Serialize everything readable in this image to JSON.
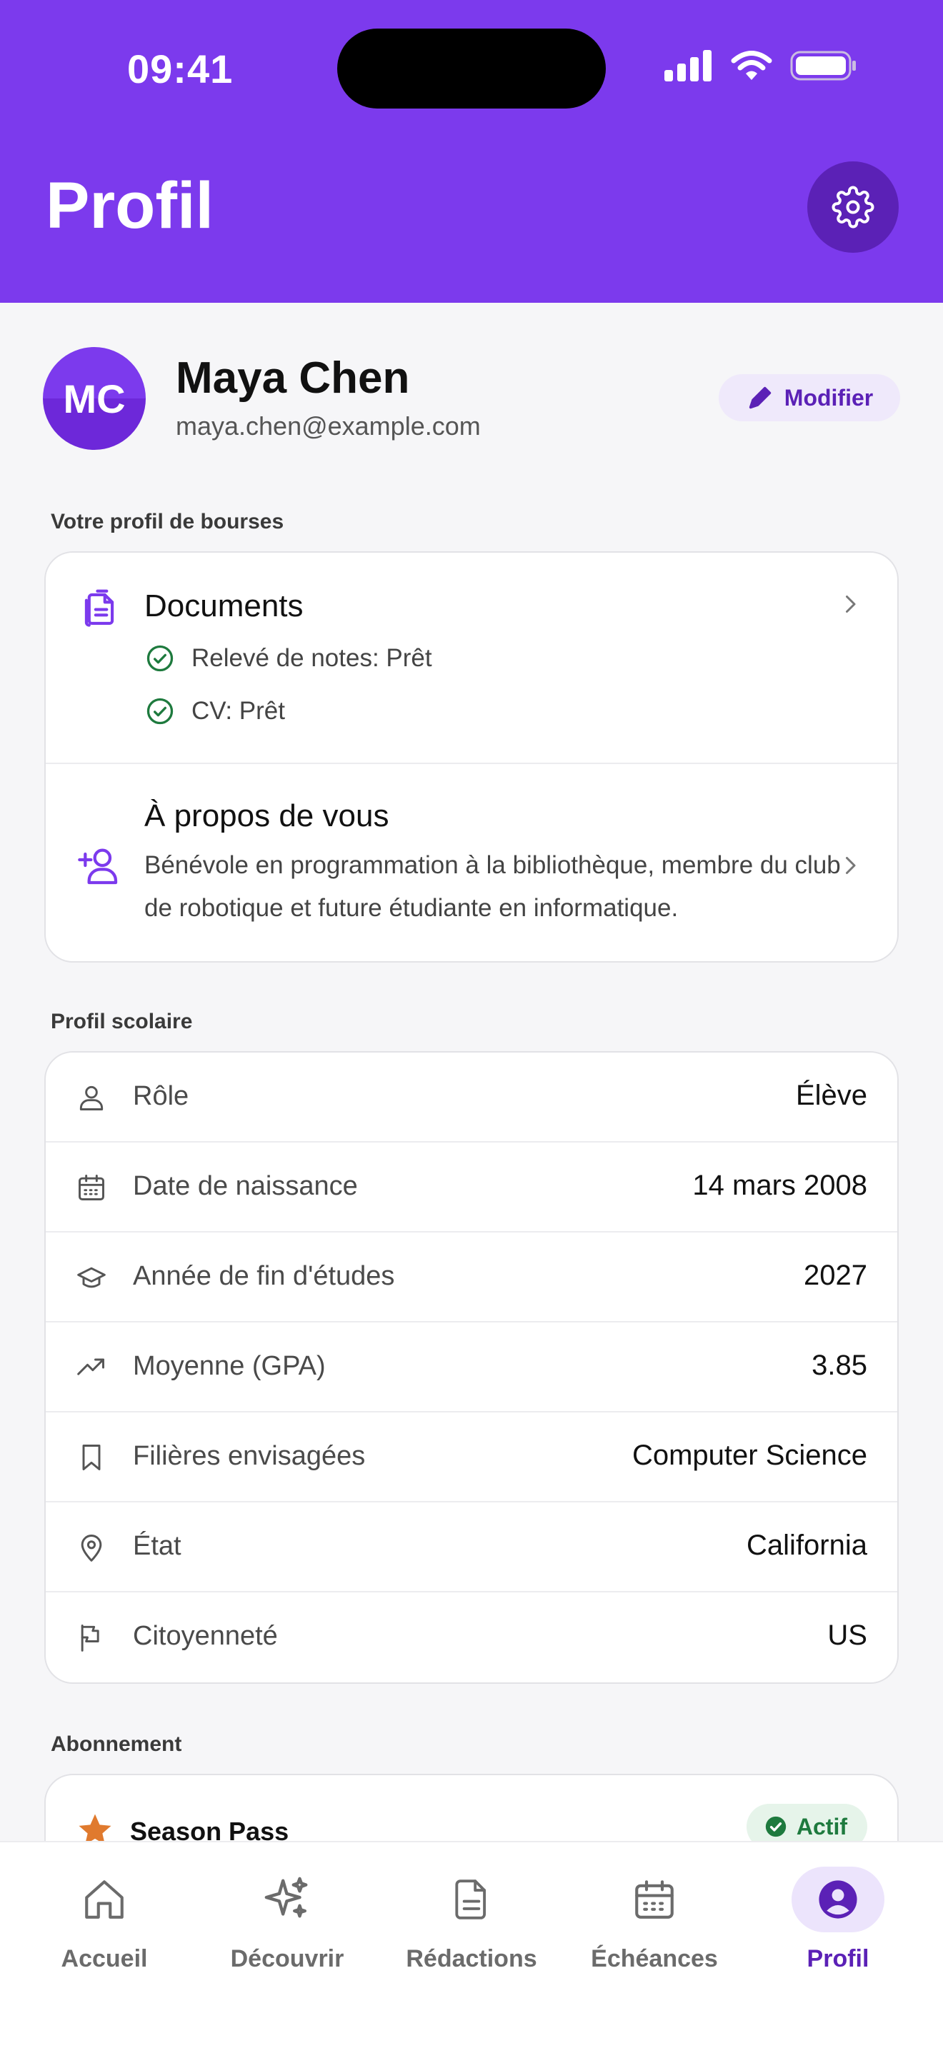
{
  "status_bar": {
    "time": "09:41"
  },
  "header": {
    "title": "Profil"
  },
  "user": {
    "initials": "MC",
    "name": "Maya Chen",
    "email": "maya.chen@example.com",
    "edit_label": "Modifier"
  },
  "scholarship_section": {
    "label": "Votre profil de bourses",
    "documents": {
      "title": "Documents",
      "items": [
        {
          "text": "Relevé de notes: Prêt"
        },
        {
          "text": "CV: Prêt"
        }
      ]
    },
    "about": {
      "title": "À propos de vous",
      "text": "Bénévole en programmation à la bibliothèque, membre du club de robotique et future étudiante en informatique."
    }
  },
  "academic_section": {
    "label": "Profil scolaire",
    "rows": [
      {
        "icon": "person-icon",
        "label": "Rôle",
        "value": "Élève"
      },
      {
        "icon": "calendar-icon",
        "label": "Date de naissance",
        "value": "14 mars 2008"
      },
      {
        "icon": "graduation-cap-icon",
        "label": "Année de fin d'études",
        "value": "2027"
      },
      {
        "icon": "trending-up-icon",
        "label": "Moyenne (GPA)",
        "value": "3.85"
      },
      {
        "icon": "bookmark-icon",
        "label": "Filières envisagées",
        "value": "Computer Science"
      },
      {
        "icon": "location-pin-icon",
        "label": "État",
        "value": "California"
      },
      {
        "icon": "flag-icon",
        "label": "Citoyenneté",
        "value": "US"
      }
    ]
  },
  "subscription_section": {
    "label": "Abonnement",
    "plan": "Season Pass",
    "status": "Actif"
  },
  "tabbar": {
    "tabs": [
      {
        "label": "Accueil",
        "icon": "home-icon",
        "active": false
      },
      {
        "label": "Découvrir",
        "icon": "sparkles-icon",
        "active": false
      },
      {
        "label": "Rédactions",
        "icon": "document-icon",
        "active": false
      },
      {
        "label": "Échéances",
        "icon": "calendar-icon",
        "active": false
      },
      {
        "label": "Profil",
        "icon": "profile-icon",
        "active": true
      }
    ]
  },
  "colors": {
    "primary": "#7c3aed",
    "primary_dark": "#5b21b6",
    "success": "#1e7a3e",
    "star": "#e07a2e"
  }
}
